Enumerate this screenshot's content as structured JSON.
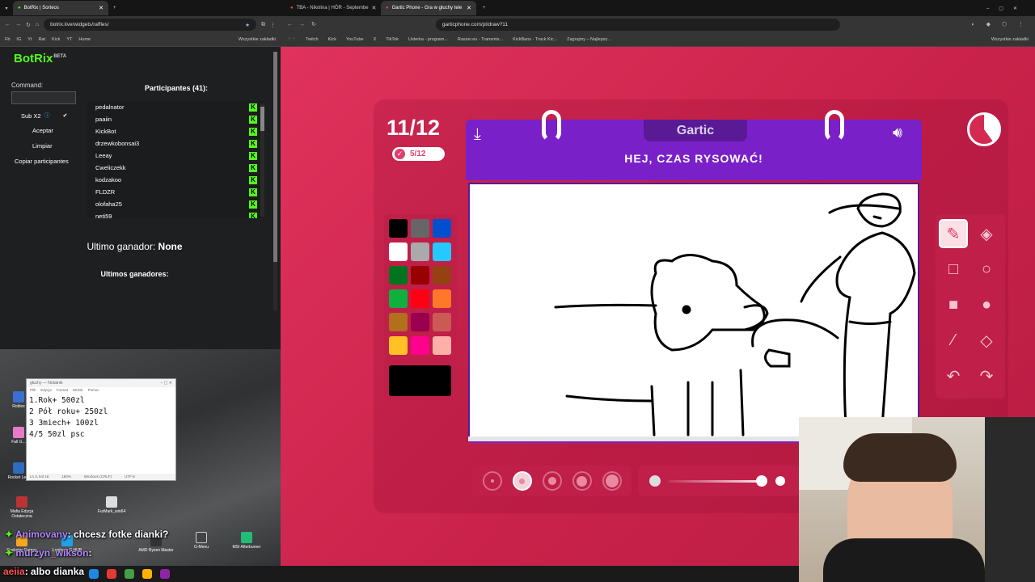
{
  "left_browser": {
    "tab_label": "BotRix | Sorteos",
    "url": "botrix.live/widgets/raffles/",
    "bookmarks": [
      "Fb",
      "IG",
      "Yt",
      "Rat",
      "Kick",
      "YT",
      "Home"
    ],
    "bookmarks_right": "Wszystkie zakładki"
  },
  "botrix": {
    "logo": "BotRix",
    "logo_badge": "BETA",
    "command_label": "Command:",
    "command_value": "",
    "sub_label": "Sub X2",
    "accept_label": "Aceptar",
    "clear_label": "Limpiar",
    "copy_label": "Copiar participantes",
    "participants_title": "Participantes (41):",
    "participants": [
      "pedalnator",
      "paaiin",
      "KickBot",
      "drzewkobonsai3",
      "Leeay",
      "Cweliczekk",
      "kodzakoo",
      "FLDZR",
      "olofaha25",
      "neti59"
    ],
    "last_winner_label": "Ultimo ganador:",
    "last_winner_value": "None",
    "last_winners_label": "Ultimos ganadores:",
    "accent_color": "#53fc18"
  },
  "right_browser": {
    "tabs": [
      "TBA - Nikolina | HÖR - Septembe",
      "Gartic Phone - Gra w głuchy tele"
    ],
    "url": "garticphone.com/pl/draw?11",
    "bookmarks": [
      "Twitch",
      "Kick",
      "YouTube",
      "X",
      "TikTok",
      "Usterka - program...",
      "Raszei.eu - Transmis...",
      "KickBans - Track Kic...",
      "Zagrajmy – Najlepsz..."
    ],
    "bookmarks_right": "Wszystkie zakładki"
  },
  "game": {
    "round": "11/12",
    "done_count": "5/12",
    "logo": "Gartic",
    "instruction": "HEJ, CZAS RYSOWAĆ!",
    "palette": [
      "#000000",
      "#666666",
      "#0050cd",
      "#ffffff",
      "#aaaaaa",
      "#26c9ff",
      "#017420",
      "#990000",
      "#964112",
      "#11b03c",
      "#ff0013",
      "#ff7829",
      "#b0701c",
      "#99004e",
      "#cb5a57",
      "#ffc126",
      "#ff008f",
      "#feafa8"
    ],
    "selected_color": "#000000",
    "stroke_sizes": 5,
    "selected_stroke": 2,
    "opacity_level": 1.0,
    "tools": [
      "pencil-icon",
      "eraser-icon",
      "rect-outline-icon",
      "circle-outline-icon",
      "rect-filled-icon",
      "circle-filled-icon",
      "line-icon",
      "fill-icon",
      "undo-icon",
      "redo-icon"
    ],
    "bg_color": "#d42a52"
  },
  "notepad": {
    "title": "głuchy — Notatnik",
    "menu": [
      "Plik",
      "Edycja",
      "Format",
      "Widok",
      "Pomoc"
    ],
    "lines": [
      "1.Rok+ 500zl",
      "2 Pół roku+ 250zl",
      "3 3miech+ 100zl",
      "4/5 50zl psc"
    ],
    "status": [
      "Ln 3, kol 16",
      "160%",
      "Windows (CRLF)",
      "UTF-8"
    ]
  },
  "desktop": {
    "icons": [
      "Roblox",
      "Fall G...",
      "Rocket Le...",
      "Mafia Edycja Ostateczna",
      "FurMark_win64",
      "Rockstar Games",
      "Logitech G HUB",
      "AMD Ryzen Master",
      "G-Menu",
      "MSI Afterburner"
    ]
  },
  "chat": [
    {
      "user": "Animovany",
      "text": "chcesz fotke dianki?"
    },
    {
      "user": "murzyn_wikson",
      "text": ""
    },
    {
      "user": "aeiia",
      "text": "albo dianka"
    }
  ]
}
